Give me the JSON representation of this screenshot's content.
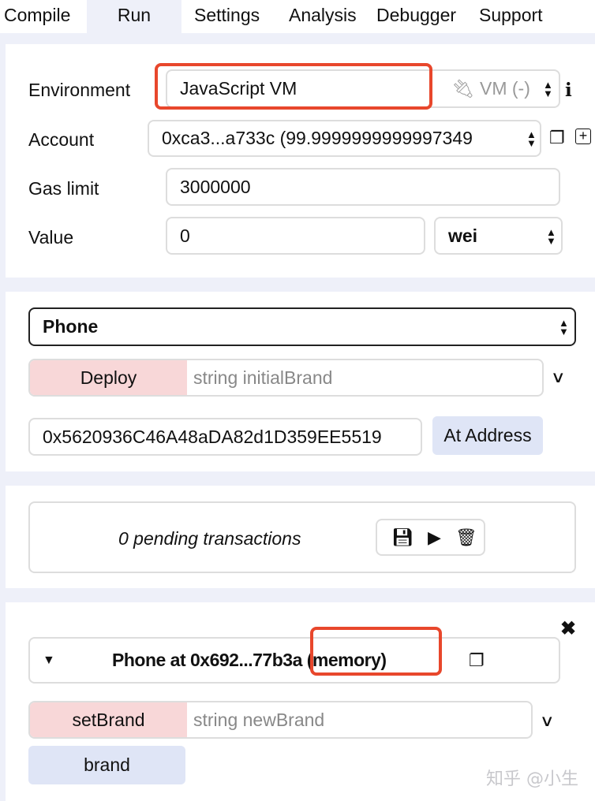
{
  "tabs": [
    {
      "label": "Compile"
    },
    {
      "label": "Run",
      "active": true
    },
    {
      "label": "Settings"
    },
    {
      "label": "Analysis"
    },
    {
      "label": "Debugger"
    },
    {
      "label": "Support"
    }
  ],
  "settings": {
    "environment_label": "Environment",
    "environment_value": "JavaScript VM",
    "vm_status": "VM (-)",
    "info_icon": "i",
    "account_label": "Account",
    "account_value": "0xca3...a733c (99.9999999999997349",
    "gas_label": "Gas limit",
    "gas_value": "3000000",
    "value_label": "Value",
    "value_value": "0",
    "unit_value": "wei"
  },
  "contract": {
    "selected": "Phone",
    "deploy_label": "Deploy",
    "deploy_placeholder": "string initialBrand",
    "address_value": "0x5620936C46A48aDA82d1D359EE5519",
    "at_address_label": "At Address"
  },
  "pending": {
    "text": "0 pending transactions"
  },
  "instance": {
    "title": "Phone at 0x692...77b3a (memory)",
    "setbrand_label": "setBrand",
    "setbrand_placeholder": "string newBrand",
    "brand_label": "brand"
  },
  "watermark": "知乎 @小生",
  "colors": {
    "highlight": "#e8472c",
    "transact": "#f8d7d8",
    "call": "#dfe5f6"
  }
}
